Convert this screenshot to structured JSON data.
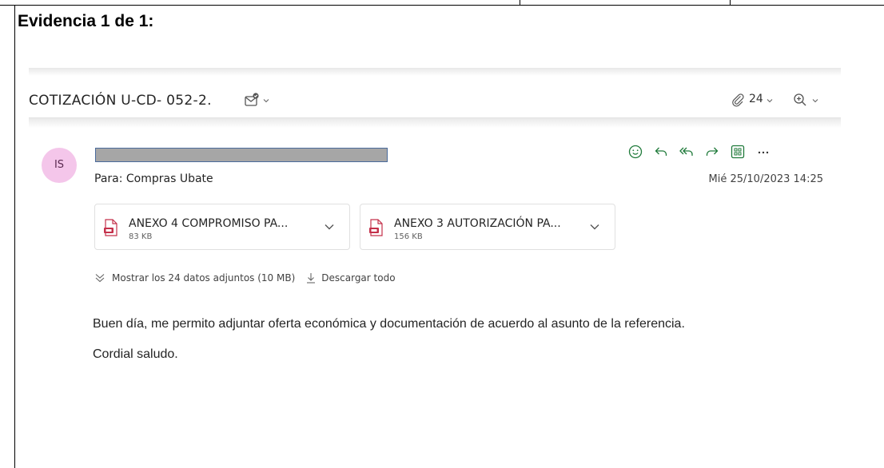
{
  "document": {
    "evidence_title": "Evidencia 1 de 1:"
  },
  "email": {
    "subject": "COTIZACIÓN U-CD- 052-2.",
    "attachment_count": "24",
    "sender_initials": "IS",
    "to_line": "Para: Compras Ubate",
    "date": "Mié 25/10/2023 14:25",
    "attachments": [
      {
        "name": "ANEXO 4 COMPROMISO PA...",
        "size": "83 KB"
      },
      {
        "name": "ANEXO 3 AUTORIZACIÓN PA...",
        "size": "156 KB"
      }
    ],
    "show_all_label": "Mostrar los 24 datos adjuntos (10 MB)",
    "download_all_label": "Descargar todo",
    "body_line1": "Buen día, me permito adjuntar oferta económica y documentación de acuerdo al asunto de la referencia.",
    "body_line2": "Cordial saludo.",
    "action_icons": [
      "emoji-icon",
      "reply-icon",
      "reply-all-icon",
      "forward-icon",
      "apps-icon",
      "more-icon"
    ]
  },
  "colors": {
    "action_green": "#1f7a3a",
    "avatar_bg": "#f4c6ea",
    "attachment_red": "#c4314b"
  }
}
